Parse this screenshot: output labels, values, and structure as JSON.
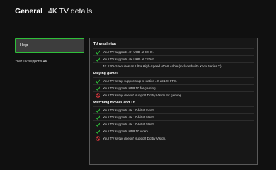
{
  "header": {
    "section": "General",
    "title": "4K TV details"
  },
  "sidebar": {
    "help_label": "Help",
    "description": "Your TV supports 4K."
  },
  "details": {
    "sections": [
      {
        "heading": "TV resolution",
        "rows": [
          {
            "status": "ok",
            "text": "Your TV supports 4K UHD at 60Hz."
          },
          {
            "status": "ok",
            "text": "Your TV supports 4K UHD at 120Hz."
          },
          {
            "status": "note",
            "text": "4K 120Hz requires an Ultra High-Speed HDMI cable (included with Xbox Series X)."
          }
        ]
      },
      {
        "heading": "Playing games",
        "rows": [
          {
            "status": "ok",
            "text": "Your TV setup supports up to native 4K at 120 FPS."
          },
          {
            "status": "ok",
            "text": "Your TV supports HDR10 for gaming."
          },
          {
            "status": "no",
            "text": "Your TV setup doesn't support Dolby Vision for gaming."
          }
        ]
      },
      {
        "heading": "Watching movies and TV",
        "rows": [
          {
            "status": "ok",
            "text": "Your TV supports 4K 10-bit at 24Hz."
          },
          {
            "status": "ok",
            "text": "Your TV supports 4K 10-bit at 50Hz."
          },
          {
            "status": "ok",
            "text": "Your TV supports 4K 10-bit at 60Hz."
          },
          {
            "status": "ok",
            "text": "Your TV supports HDR10 video."
          },
          {
            "status": "no",
            "text": "Your TV setup doesn't support Dolby Vision."
          }
        ]
      }
    ]
  },
  "colors": {
    "accent": "#2fbf3a",
    "error": "#e0383e",
    "background": "#101010"
  }
}
